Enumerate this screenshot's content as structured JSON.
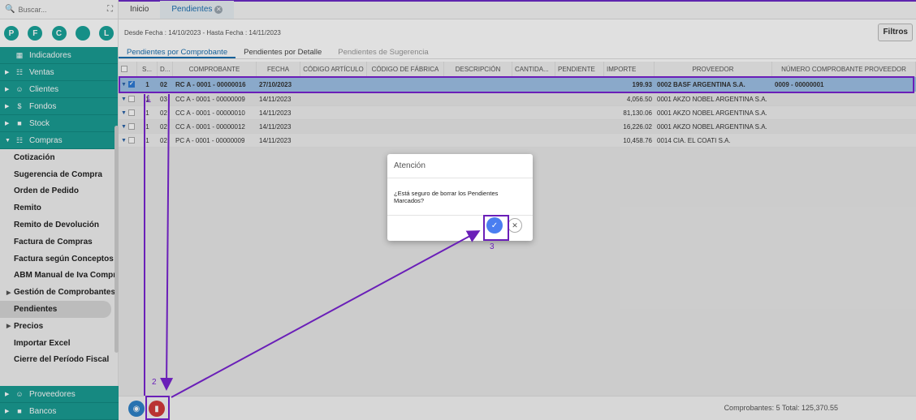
{
  "sidebar": {
    "search_placeholder": "Buscar...",
    "circles": [
      "P",
      "F",
      "C",
      "",
      "L"
    ],
    "top_menu": [
      {
        "label": "Indicadores",
        "icon": "dashboard-icon"
      },
      {
        "label": "Ventas",
        "icon": "cart-icon"
      },
      {
        "label": "Clientes",
        "icon": "users-icon"
      },
      {
        "label": "Fondos",
        "icon": "dollar-icon"
      },
      {
        "label": "Stock",
        "icon": "box-icon"
      },
      {
        "label": "Compras",
        "icon": "cart-icon"
      }
    ],
    "compras_items": [
      "Cotización",
      "Sugerencia de Compra",
      "Orden de Pedido",
      "Remito",
      "Remito de Devolución",
      "Factura de Compras",
      "Factura según Conceptos",
      "ABM Manual de Iva Compras",
      "Gestión de Comprobantes",
      "Pendientes",
      "Precios",
      "Importar Excel",
      "Cierre del Período Fiscal"
    ],
    "bottom_menu": [
      {
        "label": "Proveedores",
        "icon": "users-icon"
      },
      {
        "label": "Bancos",
        "icon": "bank-icon"
      }
    ]
  },
  "tabs": {
    "home": "Inicio",
    "pendientes": "Pendientes"
  },
  "filter": {
    "range": "Desde Fecha : 14/10/2023 - Hasta Fecha : 14/11/2023",
    "filtros_label": "Filtros"
  },
  "subtabs": [
    "Pendientes por Comprobante",
    "Pendientes por Detalle",
    "Pendientes de Sugerencia"
  ],
  "grid": {
    "headers": [
      "S...",
      "D...",
      "COMPROBANTE",
      "FECHA",
      "CÓDIGO ARTÍCULO",
      "CÓDIGO DE FÁBRICA",
      "DESCRIPCIÓN",
      "CANTIDA...",
      "PENDIENTE",
      "IMPORTE",
      "PROVEEDOR",
      "NÚMERO COMPROBANTE PROVEEDOR"
    ],
    "rows": [
      {
        "s": "1",
        "d": "02",
        "comprobante": "RC A - 0001 - 00000016",
        "fecha": "27/10/2023",
        "importe": "199.93",
        "proveedor": "0002 BASF ARGENTINA S.A.",
        "numero": "0009 - 00000001"
      },
      {
        "s": "1",
        "d": "03",
        "comprobante": "CC A - 0001 - 00000009",
        "fecha": "14/11/2023",
        "importe": "4,056.50",
        "proveedor": "0001 AKZO NOBEL ARGENTINA S.A.",
        "numero": ""
      },
      {
        "s": "1",
        "d": "02",
        "comprobante": "CC A - 0001 - 00000010",
        "fecha": "14/11/2023",
        "importe": "81,130.06",
        "proveedor": "0001 AKZO NOBEL ARGENTINA S.A.",
        "numero": ""
      },
      {
        "s": "1",
        "d": "02",
        "comprobante": "CC A - 0001 - 00000012",
        "fecha": "14/11/2023",
        "importe": "16,226.02",
        "proveedor": "0001 AKZO NOBEL ARGENTINA S.A.",
        "numero": ""
      },
      {
        "s": "1",
        "d": "02",
        "comprobante": "PC A - 0001 - 00000009",
        "fecha": "14/11/2023",
        "importe": "10,458.76",
        "proveedor": "0014 CIA. EL COATI S.A.",
        "numero": ""
      }
    ]
  },
  "footer": {
    "totals": "Comprobantes:  5  Total:  125,370.55"
  },
  "dialog": {
    "title": "Atención",
    "message": "¿Está seguro de borrar los Pendientes Marcados?"
  },
  "annotations": {
    "label1": "1",
    "label2": "2",
    "label3": "3"
  }
}
